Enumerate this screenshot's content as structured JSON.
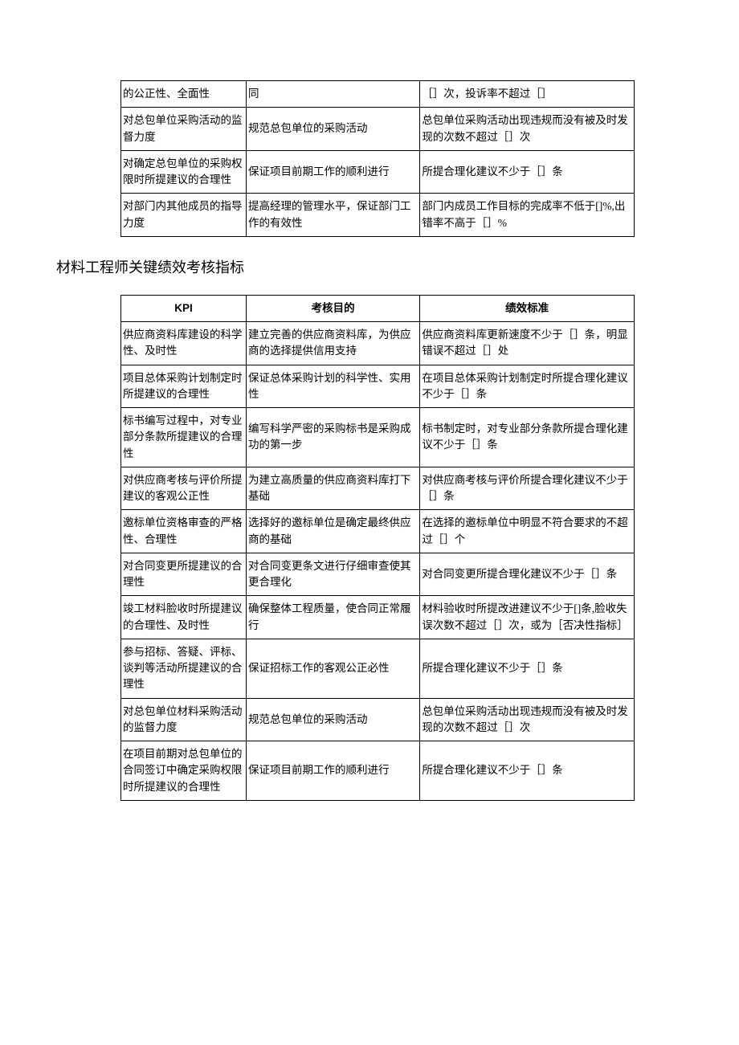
{
  "table1": {
    "rows": [
      {
        "kpi": "的公正性、全面性",
        "purpose": "同",
        "standard": "［］次，投诉率不超过［］"
      },
      {
        "kpi": "对总包单位采购活动的监督力度",
        "purpose": "规范总包单位的采购活动",
        "standard": "总包单位采购活动出现违规而没有被及时发现的次数不超过［］次"
      },
      {
        "kpi": "对确定总包单位的采购权限时所提建议的合理性",
        "purpose": "保证项目前期工作的顺利进行",
        "standard": "所提合理化建议不少于［］条"
      },
      {
        "kpi": "对部门内其他成员的指导力度",
        "purpose": "提高经理的管理水平，保证部门工作的有效性",
        "standard": "部门内成员工作目标的完成率不低于[]%,出错率不高于［］%"
      }
    ]
  },
  "section_title": "材料工程师关键绩效考核指标",
  "table2": {
    "headers": {
      "kpi": "KPI",
      "purpose": "考核目的",
      "standard": "绩效标准"
    },
    "rows": [
      {
        "kpi": "供应商资料库建设的科学性、及时性",
        "purpose": "建立完善的供应商资料库，为供应商的选择提供信用支持",
        "standard": "供应商资料库更新速度不少于［］条，明显错误不超过［］处"
      },
      {
        "kpi": "项目总体采购计划制定时所提建议的合理性",
        "purpose": "保证总体采购计划的科学性、实用性",
        "standard": "在项目总体采购计划制定时所提合理化建议不少于［］条"
      },
      {
        "kpi": "标书编写过程中，对专业部分条款所提建议的合理性",
        "purpose": "编写科学严密的采购标书是采购成功的第一步",
        "standard": "标书制定时，对专业部分条款所提合理化建议不少于［］条"
      },
      {
        "kpi": "对供应商考核与评价所提建议的客观公正性",
        "purpose": "为建立高质量的供应商资料库打下基础",
        "standard": "对供应商考核与评价所提合理化建议不少于［］条"
      },
      {
        "kpi": "邀标单位资格审查的严格性、合理性",
        "purpose": "选择好的邀标单位是确定最终供应商的基础",
        "standard": "在选择的邀标单位中明显不符合要求的不超过［］个"
      },
      {
        "kpi": "对合同变更所提建议的合理性",
        "purpose": "对合同变更条文进行仔细审查使其更合理化",
        "standard": "对合同变更所提合理化建议不少于［］条"
      },
      {
        "kpi": "竣工材料脸收时所提建议的合理性、及时性",
        "purpose": "确保整体工程质量，使合同正常履行",
        "standard": "材料验收时所提改进建议不少于[]条,脸收失误次数不超过［］次，或为［否决性指标］"
      },
      {
        "kpi": "参与招标、答疑、评标、谈判等活动所提建议的合理性",
        "purpose": "保证招标工作的客观公正必性",
        "standard": "所提合理化建议不少于［］条"
      },
      {
        "kpi": "对总包单位材料采购活动的监督力度",
        "purpose": "规范总包单位的采购活动",
        "standard": "总包单位采购活动出现违规而没有被及时发现的次数不超过［］次"
      },
      {
        "kpi": "在项目前期对总包单位的合同签订中确定采购权限时所提建议的合理性",
        "purpose": "保证项目前期工作的顺利进行",
        "standard": "所提合理化建议不少于［］条"
      }
    ]
  }
}
